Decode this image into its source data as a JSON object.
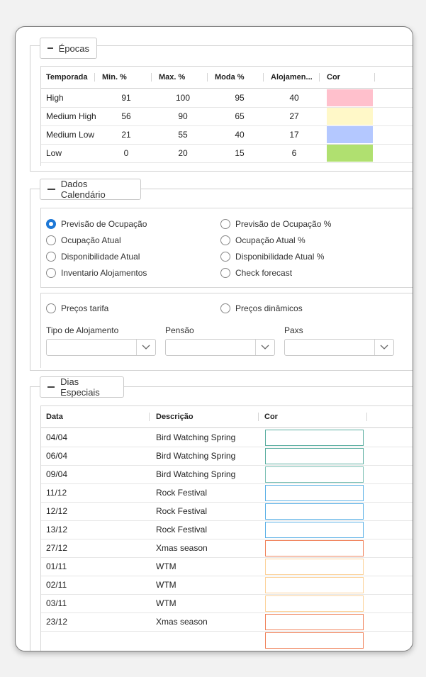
{
  "epocas": {
    "title": "Épocas",
    "columns": [
      "Temporada",
      "Min. %",
      "Max. %",
      "Moda %",
      "Alojamen...",
      "Cor"
    ],
    "rows": [
      {
        "temporada": "High",
        "min": "91",
        "max": "100",
        "moda": "95",
        "aloj": "40",
        "color": "#ffc0cc"
      },
      {
        "temporada": "Medium High",
        "min": "56",
        "max": "90",
        "moda": "65",
        "aloj": "27",
        "color": "#fff8c8"
      },
      {
        "temporada": "Medium Low",
        "min": "21",
        "max": "55",
        "moda": "40",
        "aloj": "17",
        "color": "#b4c8ff"
      },
      {
        "temporada": "Low",
        "min": "0",
        "max": "20",
        "moda": "15",
        "aloj": "6",
        "color": "#b0e070"
      }
    ]
  },
  "dados": {
    "title": "Dados Calendário",
    "radios_left": [
      "Previsão de Ocupação",
      "Ocupação Atual",
      "Disponibilidade Atual",
      "Inventario Alojamentos"
    ],
    "radios_right": [
      "Previsão de Ocupação %",
      "Ocupação Atual %",
      "Disponibilidade Atual %",
      "Check forecast"
    ],
    "price_left": "Preços tarifa",
    "price_right": "Preços dinâmicos",
    "tipo_label": "Tipo de Alojamento",
    "pensao_label": "Pensão",
    "paxs_label": "Paxs",
    "tipo_value": "",
    "pensao_value": "",
    "paxs_value": ""
  },
  "dias": {
    "title": "Dias Especiais",
    "columns": [
      "Data",
      "Descrição",
      "Cor"
    ],
    "rows": [
      {
        "data": "04/04",
        "desc": "Bird Watching Spring",
        "border": "#5aaea0"
      },
      {
        "data": "06/04",
        "desc": "Bird Watching Spring",
        "border": "#5aaea0"
      },
      {
        "data": "09/04",
        "desc": "Bird Watching Spring",
        "border": "#7cc0b4"
      },
      {
        "data": "11/12",
        "desc": "Rock Festival",
        "border": "#5ab0e6"
      },
      {
        "data": "12/12",
        "desc": "Rock Festival",
        "border": "#5ab0e6"
      },
      {
        "data": "13/12",
        "desc": "Rock Festival",
        "border": "#5ab0e6"
      },
      {
        "data": "27/12",
        "desc": "Xmas season",
        "border": "#f0825a"
      },
      {
        "data": "01/11",
        "desc": "WTM",
        "border": "#fcd29a"
      },
      {
        "data": "02/11",
        "desc": "WTM",
        "border": "#fcd29a"
      },
      {
        "data": "03/11",
        "desc": "WTM",
        "border": "#fcd29a"
      },
      {
        "data": "23/12",
        "desc": "Xmas season",
        "border": "#f0825a"
      }
    ]
  }
}
